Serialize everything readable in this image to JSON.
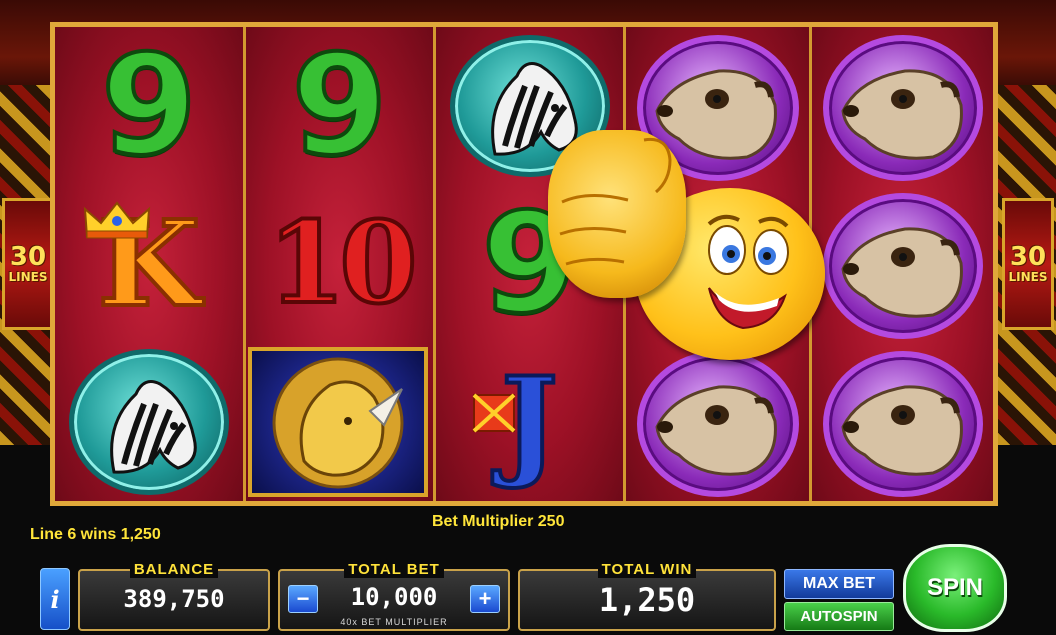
{
  "game": {
    "lines_badge": {
      "number": "30",
      "label": "LINES"
    }
  },
  "reels": [
    [
      "9",
      "K",
      "zebra"
    ],
    [
      "9",
      "10",
      "rhino"
    ],
    [
      "zebra",
      "9",
      "J"
    ],
    [
      "meerkat",
      "",
      "meerkat"
    ],
    [
      "meerkat",
      "meerkat",
      "meerkat"
    ]
  ],
  "messages": {
    "line_win": "Line 6 wins 1,250",
    "bet_multiplier": "Bet Multiplier 250"
  },
  "panel": {
    "balance_label": "BALANCE",
    "balance_value": "389,750",
    "total_bet_label": "TOTAL BET",
    "total_bet_value": "10,000",
    "bet_minus": "−",
    "bet_plus": "+",
    "bet_note": "40x BET MULTIPLIER",
    "total_win_label": "TOTAL WIN",
    "total_win_value": "1,250",
    "info": "i"
  },
  "buttons": {
    "max_bet": "MAX BET",
    "autospin": "AUTOSPIN",
    "spin": "SPIN"
  },
  "icons": [
    "zebra-icon",
    "rhino-icon",
    "meerkat-icon",
    "thumbs-up-emoji-icon",
    "crown-icon",
    "info-icon"
  ]
}
